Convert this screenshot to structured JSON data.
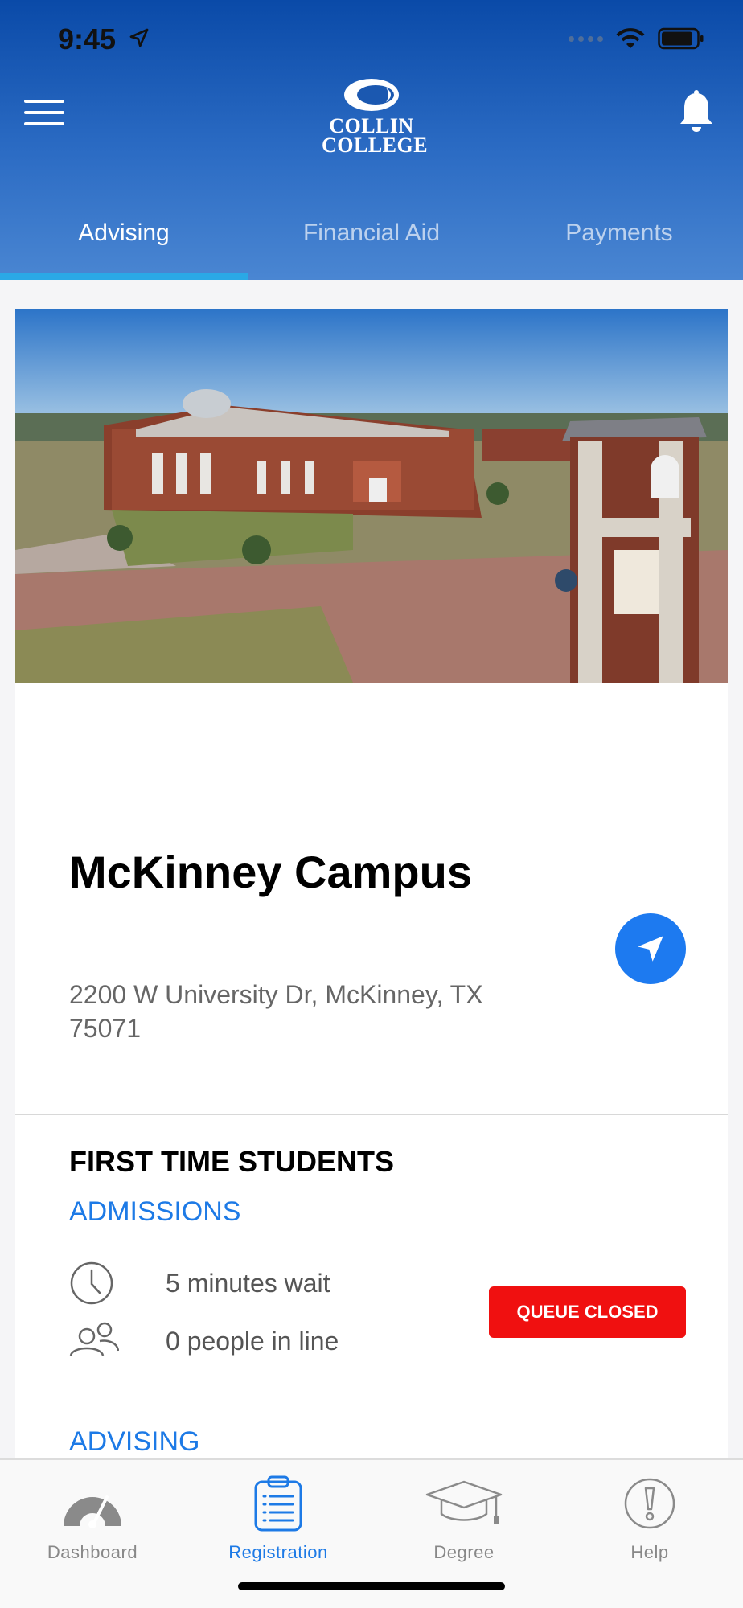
{
  "status_bar": {
    "time": "9:45"
  },
  "header": {
    "logo_line1": "COLLIN",
    "logo_line2": "COLLEGE"
  },
  "tabs": [
    {
      "label": "Advising",
      "active": true
    },
    {
      "label": "Financial Aid",
      "active": false
    },
    {
      "label": "Payments",
      "active": false
    }
  ],
  "campus": {
    "name": "McKinney Campus",
    "address": "2200 W University Dr, McKinney, TX 75071"
  },
  "section": {
    "title": "FIRST TIME STUDENTS",
    "admissions_link": "ADMISSIONS",
    "wait_time": "5 minutes wait",
    "people_in_line": "0 people in line",
    "queue_status": "QUEUE CLOSED",
    "advising_link": "ADVISING"
  },
  "bottom_nav": [
    {
      "label": "Dashboard",
      "icon": "dashboard-gauge-icon"
    },
    {
      "label": "Registration",
      "icon": "clipboard-list-icon",
      "active": true
    },
    {
      "label": "Degree",
      "icon": "graduation-cap-icon"
    },
    {
      "label": "Help",
      "icon": "exclamation-circle-icon"
    }
  ],
  "colors": {
    "header_top": "#0a4aa8",
    "accent_blue": "#1d7ae6",
    "tab_indicator": "#2aa8e6",
    "queue_closed_red": "#f01010"
  }
}
